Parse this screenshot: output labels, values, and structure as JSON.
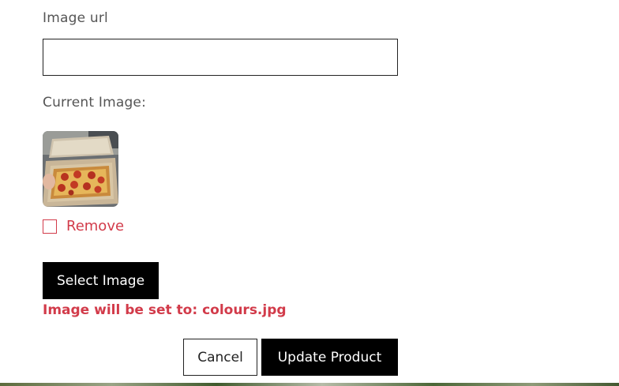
{
  "form": {
    "image_url_label": "Image url",
    "image_url_value": "",
    "image_url_placeholder": "",
    "current_image_label": "Current Image:",
    "current_image_icon": "pizza-photo",
    "remove_label": "Remove",
    "remove_checked": false,
    "select_image_label": "Select Image",
    "status_text": "Image will be set to: colours.jpg",
    "cancel_label": "Cancel",
    "update_label": "Update Product"
  },
  "colors": {
    "accent_red": "#d23b4a",
    "button_dark": "#000000",
    "label_gray": "#555555"
  }
}
